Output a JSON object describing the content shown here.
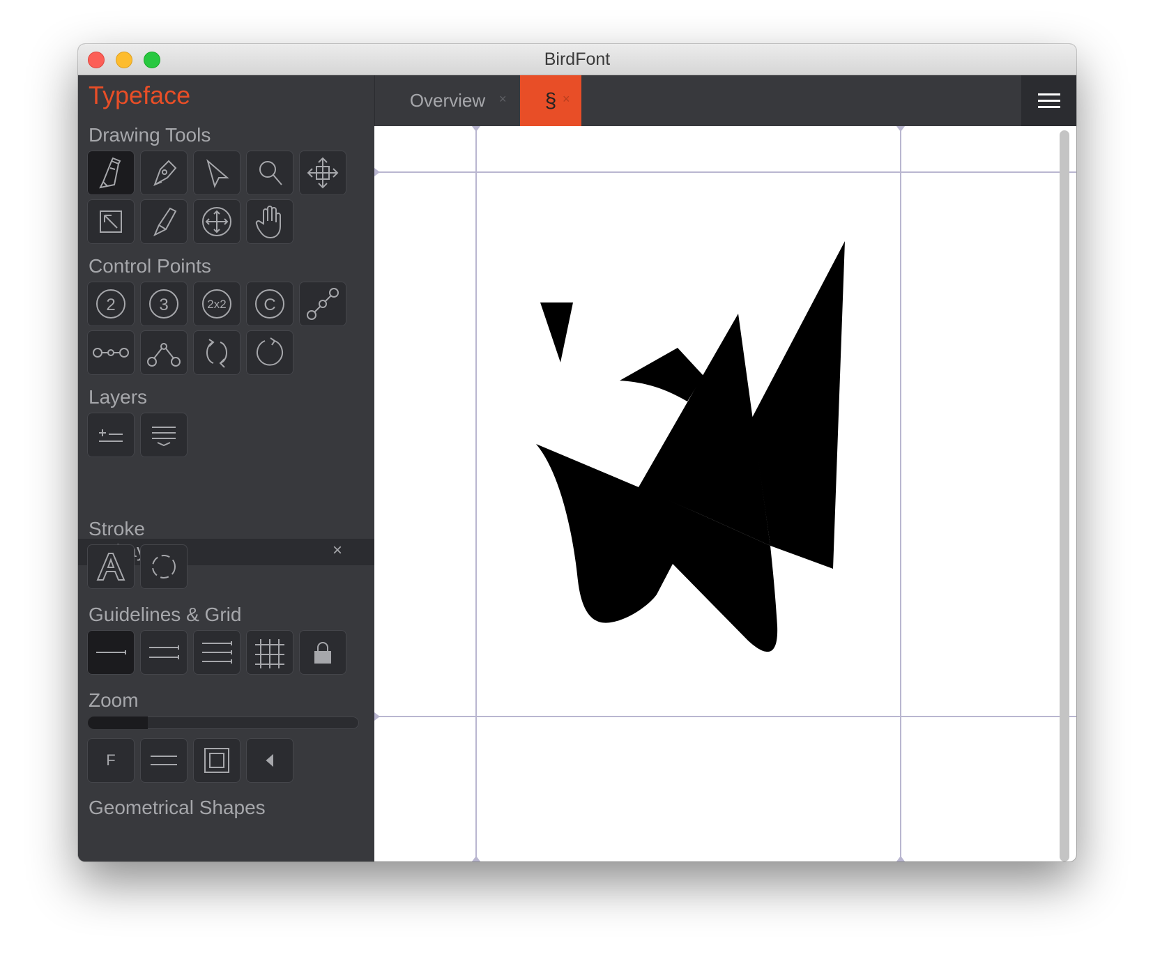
{
  "window": {
    "title": "BirdFont"
  },
  "sidebar": {
    "app_name": "Typeface",
    "sections": {
      "drawing_tools": "Drawing Tools",
      "control_points": "Control Points",
      "layers": "Layers",
      "stroke": "Stroke",
      "guidelines_grid": "Guidelines & Grid",
      "zoom": "Zoom",
      "geometrical_shapes": "Geometrical Shapes"
    },
    "control_point_labels": {
      "quadratic": "2",
      "cubic": "3",
      "double": "2x2",
      "convert": "C"
    },
    "layer_item": {
      "label": "Layer",
      "close": "×"
    },
    "zoom": {
      "fit_label": "F",
      "level": 0.22
    }
  },
  "tabs": [
    {
      "label": "Overview",
      "close": "×",
      "active": false
    },
    {
      "label": "§",
      "close": "×",
      "active": true
    }
  ],
  "colors": {
    "accent": "#e84e27",
    "panel": "#38393d",
    "button": "#2b2c30",
    "button_active": "#1b1b1e",
    "icon": "#a6a7ab",
    "guide": "#b9b6d0"
  },
  "icons": {
    "drawing_tools": [
      "pen-icon",
      "pencil-icon",
      "pointer-icon",
      "zoom-icon",
      "move-icon",
      "resize-icon",
      "brush-icon",
      "rotate-move-icon",
      "hand-icon"
    ],
    "control_points": [
      "quadratic-icon",
      "cubic-icon",
      "double-point-icon",
      "convert-point-icon",
      "join-points-icon",
      "line-points-icon",
      "corner-points-icon",
      "flip-direction-icon",
      "close-path-icon"
    ],
    "layers": [
      "add-layer-icon",
      "layer-list-icon"
    ],
    "stroke": [
      "outline-font-icon",
      "dashed-stroke-icon"
    ],
    "guidelines": [
      "show-guides-icon",
      "help-lines-icon",
      "more-lines-icon",
      "grid-icon",
      "lock-icon"
    ],
    "zoom": [
      "fit-icon",
      "zoom-lines-icon",
      "full-glyph-icon",
      "previous-view-icon"
    ]
  }
}
